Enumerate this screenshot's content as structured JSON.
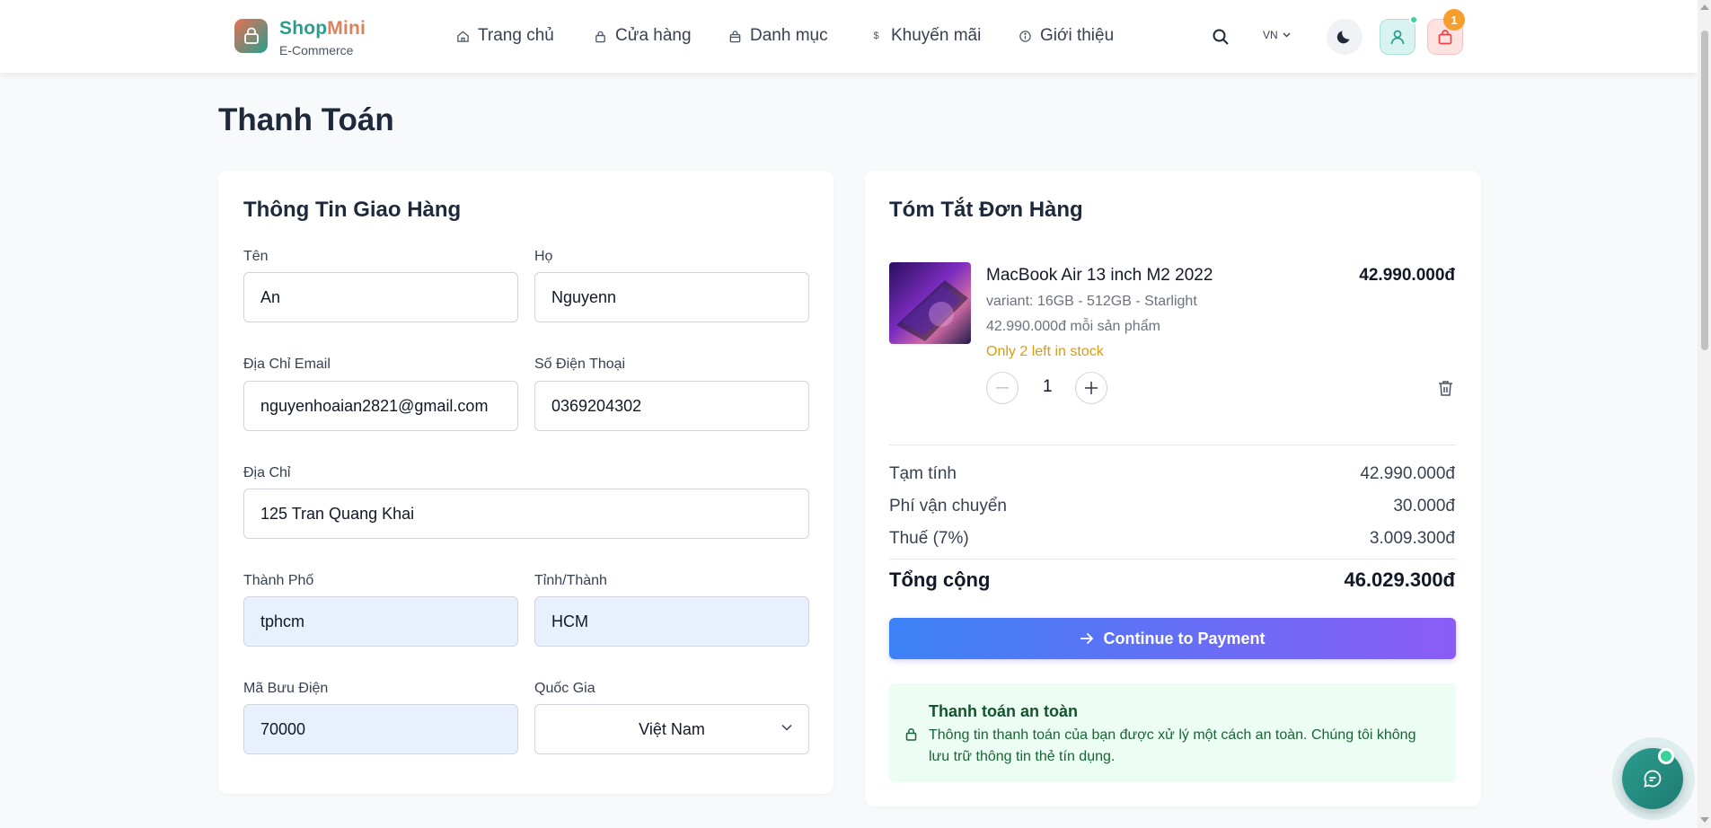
{
  "header": {
    "brand": {
      "part1": "Shop",
      "part2": "Mini",
      "subtitle": "E-Commerce"
    },
    "nav": [
      {
        "label": "Trang chủ",
        "icon": "home-icon"
      },
      {
        "label": "Cửa hàng",
        "icon": "lock-icon"
      },
      {
        "label": "Danh mục",
        "icon": "bag-icon"
      },
      {
        "label": "Khuyến mãi",
        "icon": "dollar-icon"
      },
      {
        "label": "Giới thiệu",
        "icon": "info-icon"
      }
    ],
    "language": "VN",
    "cart_count": "1",
    "colors": {
      "brand": "#2a9d8f",
      "accent": "#d9825b",
      "badge": "#f59e2b"
    }
  },
  "page": {
    "title": "Thanh Toán"
  },
  "shipping": {
    "title": "Thông Tin Giao Hàng",
    "fields": {
      "first_name": {
        "label": "Tên",
        "value": "An"
      },
      "last_name": {
        "label": "Họ",
        "value": "Nguyenn"
      },
      "email": {
        "label": "Địa Chỉ Email",
        "value": "nguyenhoaian2821@gmail.com"
      },
      "phone": {
        "label": "Số Điện Thoại",
        "value": "0369204302"
      },
      "address": {
        "label": "Địa Chỉ",
        "value": "125 Tran Quang Khai"
      },
      "city": {
        "label": "Thành Phố",
        "value": "tphcm"
      },
      "province": {
        "label": "Tỉnh/Thành",
        "value": "HCM"
      },
      "postal": {
        "label": "Mã Bưu Điện",
        "value": "70000"
      },
      "country": {
        "label": "Quốc Gia",
        "value": "Việt Nam"
      }
    }
  },
  "summary": {
    "title": "Tóm Tắt Đơn Hàng",
    "item": {
      "name": "MacBook Air 13 inch M2 2022",
      "price": "42.990.000đ",
      "variant": "variant: 16GB - 512GB - Starlight",
      "unit_price": "42.990.000đ mỗi sản phẩm",
      "stock": "Only 2 left in stock",
      "quantity": "1"
    },
    "subtotal": {
      "label": "Tạm tính",
      "value": "42.990.000đ"
    },
    "shipping": {
      "label": "Phí vận chuyển",
      "value": "30.000đ"
    },
    "tax": {
      "label": "Thuế (7%)",
      "value": "3.009.300đ"
    },
    "total": {
      "label": "Tổng cộng",
      "value": "46.029.300đ"
    },
    "pay_button": "Continue to Payment",
    "secure": {
      "title": "Thanh toán an toàn",
      "text": "Thông tin thanh toán của bạn được xử lý một cách an toàn. Chúng tôi không lưu trữ thông tin thẻ tín dụng."
    }
  }
}
